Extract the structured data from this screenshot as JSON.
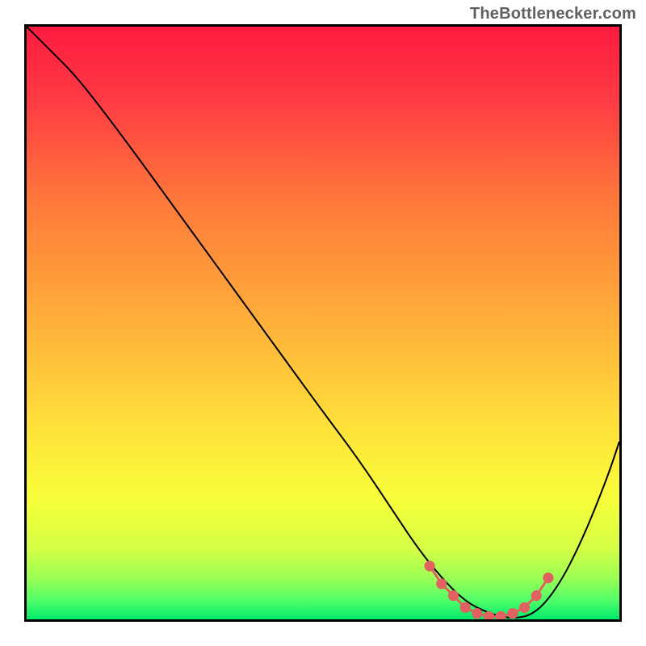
{
  "watermark": "TheBottlenecker.com",
  "chart_data": {
    "type": "line",
    "title": "",
    "xlabel": "",
    "ylabel": "",
    "xlim": [
      0,
      100
    ],
    "ylim": [
      0,
      100
    ],
    "gradient_stops": [
      {
        "offset": 0,
        "color": "#ff1a3f"
      },
      {
        "offset": 12,
        "color": "#ff3a44"
      },
      {
        "offset": 30,
        "color": "#ff7a3a"
      },
      {
        "offset": 50,
        "color": "#ffb03a"
      },
      {
        "offset": 68,
        "color": "#ffe23a"
      },
      {
        "offset": 80,
        "color": "#f7ff3a"
      },
      {
        "offset": 88,
        "color": "#d4ff44"
      },
      {
        "offset": 93,
        "color": "#9cff55"
      },
      {
        "offset": 97,
        "color": "#4cff6a"
      },
      {
        "offset": 100,
        "color": "#00e86a"
      }
    ],
    "series": [
      {
        "name": "bottleneck-curve",
        "stroke": "#000000",
        "x": [
          0,
          4,
          8,
          12,
          18,
          26,
          34,
          42,
          50,
          56,
          62,
          66,
          70,
          74,
          78,
          82,
          86,
          90,
          94,
          98,
          100
        ],
        "y": [
          100,
          96,
          92,
          87,
          79,
          68,
          57,
          46,
          35,
          27,
          18,
          12,
          7,
          3,
          1,
          0,
          1,
          6,
          14,
          24,
          30
        ]
      },
      {
        "name": "optimal-markers",
        "stroke": "#e0615f",
        "marker": true,
        "x": [
          68,
          70,
          72,
          74,
          76,
          78,
          80,
          82,
          84,
          86,
          88
        ],
        "y": [
          9,
          6,
          4,
          2,
          1,
          0.5,
          0.5,
          1,
          2,
          4,
          7
        ]
      }
    ]
  }
}
